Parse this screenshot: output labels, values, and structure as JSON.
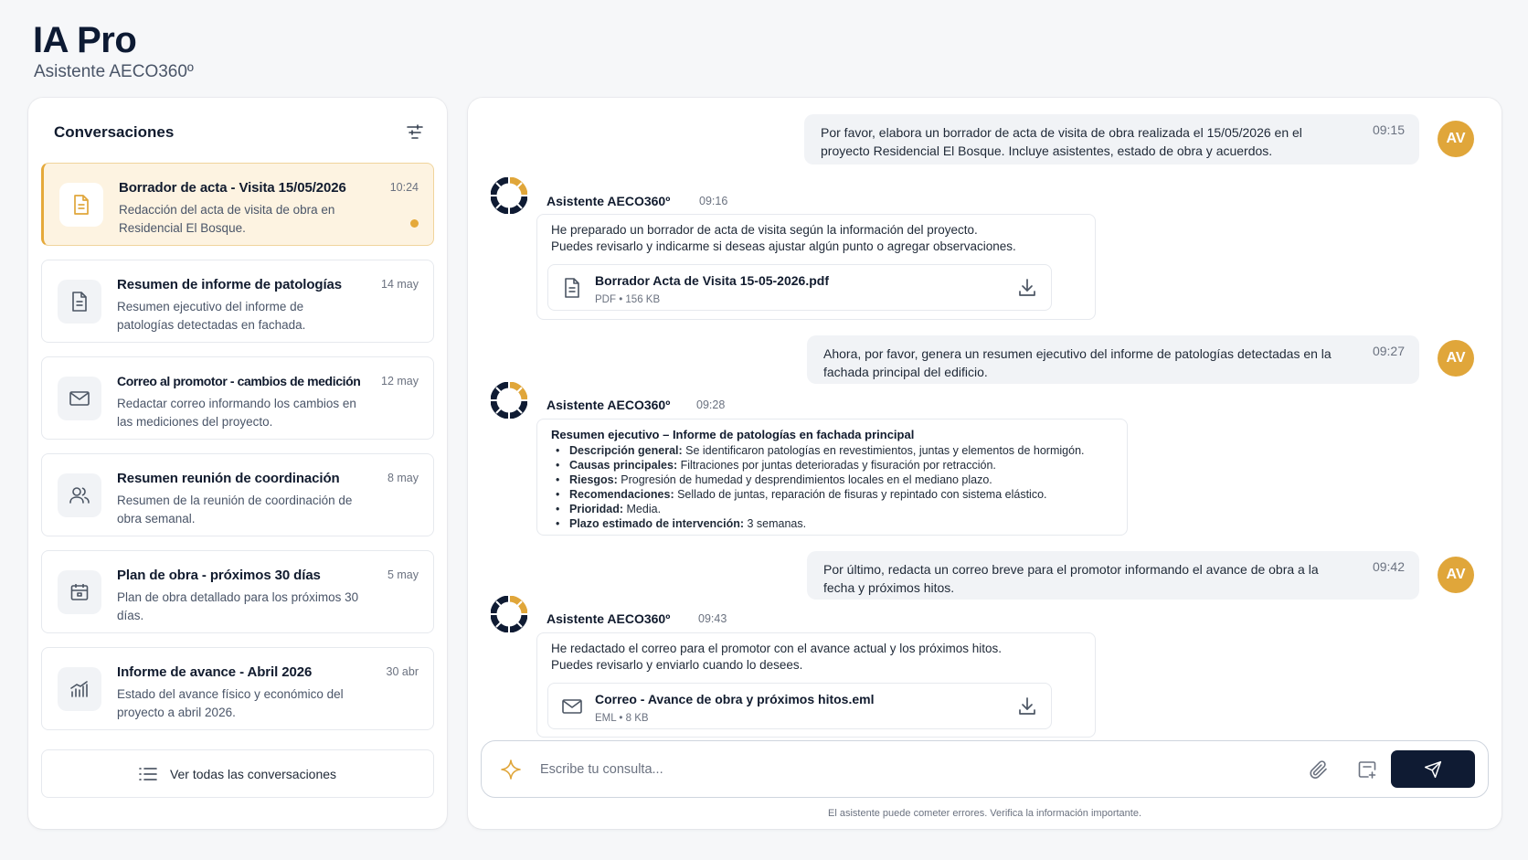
{
  "app": {
    "title": "IA Pro",
    "subtitle": "Asistente AECO360º"
  },
  "sidebar": {
    "header": "Conversaciones",
    "filter_icon": "filter-icon",
    "items": [
      {
        "icon": "document-icon",
        "title": "Borrador de acta - Visita 15/05/2026",
        "desc": "Redacción del acta de visita de obra en Residencial El Bosque.",
        "time": "10:24",
        "active": true,
        "unread": true
      },
      {
        "icon": "document-icon",
        "title": "Resumen de informe de patologías",
        "desc": "Resumen ejecutivo del informe de patologías detectadas en fachada.",
        "time": "14 may"
      },
      {
        "icon": "mail-icon",
        "title": "Correo al promotor - cambios de medición",
        "desc": "Redactar correo informando los cambios en las mediciones del proyecto.",
        "time": "12 may"
      },
      {
        "icon": "users-icon",
        "title": "Resumen reunión de coordinación",
        "desc": "Resumen de la reunión de coordinación de obra semanal.",
        "time": "8 may"
      },
      {
        "icon": "calendar-icon",
        "title": "Plan de obra - próximos 30 días",
        "desc": "Plan de obra detallado para los próximos 30 días.",
        "time": "5 may"
      },
      {
        "icon": "chart-icon",
        "title": "Informe de avance - Abril 2026",
        "desc": "Estado del avance físico y económico del proyecto a abril 2026.",
        "time": "30 abr"
      }
    ],
    "view_all": "Ver todas las conversaciones"
  },
  "chat": {
    "user_initials": "AV",
    "bot_name": "Asistente AECO360º",
    "messages": {
      "u1": {
        "text": "Por favor, elabora un borrador de acta de visita de obra realizada el 15/05/2026 en el proyecto Residencial El Bosque. Incluye asistentes, estado de obra y acuerdos.",
        "time": "09:15"
      },
      "b1": {
        "time": "09:16",
        "line1": "He preparado un borrador de acta de visita según la información del proyecto.",
        "line2": "Puedes revisarlo y indicarme si deseas ajustar algún punto o agregar observaciones.",
        "attachment": {
          "name": "Borrador Acta de Visita 15-05-2026.pdf",
          "meta": "PDF  •  156 KB"
        }
      },
      "u2": {
        "text": "Ahora, por favor, genera un resumen ejecutivo del informe de patologías detectadas en la fachada principal del edificio.",
        "time": "09:27"
      },
      "b2": {
        "time": "09:28",
        "title": "Resumen ejecutivo – Informe de patologías en fachada principal",
        "items": [
          {
            "label": "Descripción general:",
            "text": " Se identificaron patologías en revestimientos, juntas y elementos de hormigón."
          },
          {
            "label": "Causas principales:",
            "text": " Filtraciones por juntas deterioradas y fisuración por retracción."
          },
          {
            "label": "Riesgos:",
            "text": " Progresión de humedad y desprendimientos locales en el mediano plazo."
          },
          {
            "label": "Recomendaciones:",
            "text": " Sellado de juntas, reparación de fisuras y repintado con sistema elástico."
          },
          {
            "label": "Prioridad:",
            "text": " Media."
          },
          {
            "label": "Plazo estimado de intervención:",
            "text": " 3 semanas."
          }
        ]
      },
      "u3": {
        "text": "Por último, redacta un correo breve para el promotor informando el avance de obra a la fecha y próximos hitos.",
        "time": "09:42"
      },
      "b3": {
        "time": "09:43",
        "line1": "He redactado el correo para el promotor con el avance actual y los próximos hitos.",
        "line2": "Puedes revisarlo y enviarlo cuando lo desees.",
        "attachment": {
          "name": "Correo - Avance de obra y próximos hitos.eml",
          "meta": "EML  •  8 KB"
        }
      }
    },
    "composer": {
      "placeholder": "Escribe tu consulta..."
    },
    "disclaimer": "El asistente puede cometer errores. Verifica la información importante."
  },
  "colors": {
    "accent": "#e0a63a",
    "navy": "#0f1b33",
    "active_bg": "#fdf3e1"
  }
}
